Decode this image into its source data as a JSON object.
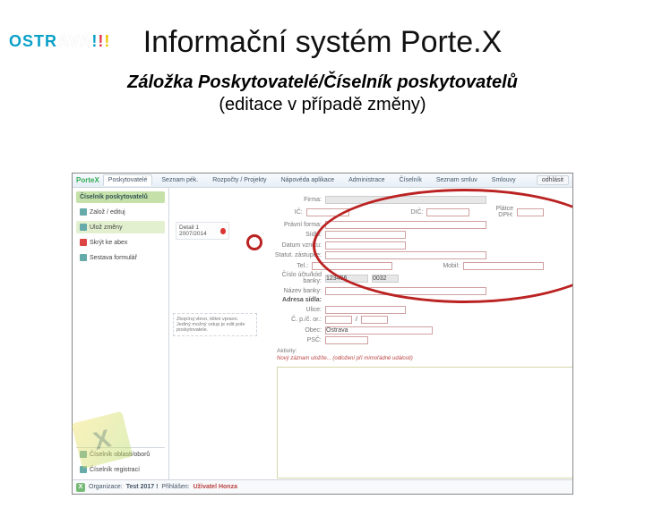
{
  "brand": {
    "text": "OSTRAVA",
    "bangs": "!!!"
  },
  "slide": {
    "title": "Informační systém Porte.X",
    "subtitleA": "Záložka Poskytovatelé/Číselník poskytovatelů",
    "subtitleB": "(editace v případě změny)"
  },
  "topbar": {
    "logo": "PorteX",
    "tabs": [
      "Poskytovatelé",
      "Seznam pék.",
      "Rozpočty / Projekty",
      "Nápovéda aplikace",
      "Administrace",
      "Číselník",
      "Seznam smluv",
      "Smlouvy"
    ],
    "activeTab": 0,
    "logout": "odhlásit"
  },
  "sidebar": {
    "header": "Číselník poskytovatelů",
    "items": [
      {
        "label": "Založ / edituj"
      },
      {
        "label": "Ulož změny",
        "hl": true
      },
      {
        "label": "Skrýt ke abex"
      },
      {
        "label": "Sestava formulář"
      }
    ],
    "bottom": [
      {
        "label": "Číselník oblasti/oborů"
      },
      {
        "label": "Číselník registrací"
      }
    ]
  },
  "side_extra": {
    "label": "Detail 1 2007/2014"
  },
  "form": {
    "labels": {
      "firma": "Firma:",
      "ic": "IČ:",
      "dic": "DIČ:",
      "platceDPH": "Plátce DPH:",
      "pravniForma": "Právní forma:",
      "sidlo": "Sídlo:",
      "datumVzniku": "Datum vzniku:",
      "statut": "Statut. zástupce:",
      "tel": "Tel.:",
      "cisloUctu": "Číslo účtu/kód banky:",
      "nazevUctu": "Název banky:",
      "akce": "Adresa sídla:",
      "ulice": "Ulice:",
      "cp": "Č. p./č. or.:",
      "slash": "/",
      "obec": "Obec:",
      "psc": "PSČ:"
    },
    "values": {
      "cisloUctu_a": "123456",
      "cisloUctu_b": "0032",
      "obec": "Ostrava"
    }
  },
  "area": {
    "label": "Aktivity:",
    "note": "Nový záznam uložíte...  (odložení pří mimořádné události)"
  },
  "hints": {
    "text": "Zkopíruj vlevo, klikni vpravo. Jediný možný vstup je edit pole poskytovatele."
  },
  "status": {
    "org": "Organizace:",
    "orgv": "Test 2017 !",
    "u": "Přihlášen:",
    "uname": "Uživatel Honza"
  },
  "watermark": "X"
}
